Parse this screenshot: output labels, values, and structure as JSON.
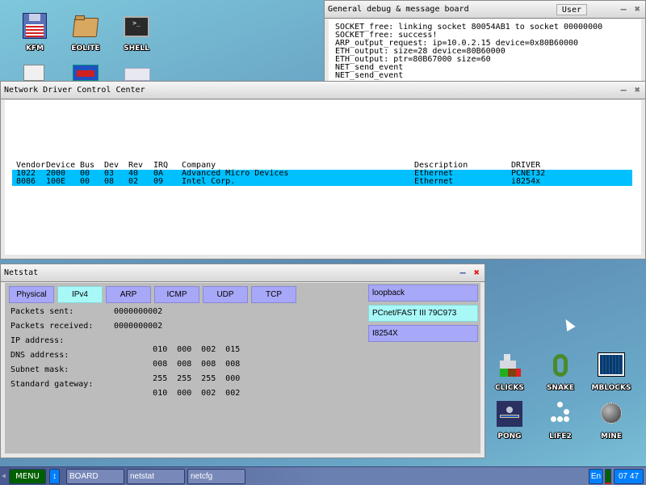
{
  "desktop": {
    "icons_top": [
      {
        "label": "KFM",
        "icon": "floppy-disk-icon"
      },
      {
        "label": "EOLITE",
        "icon": "folder-icon"
      },
      {
        "label": "SHELL",
        "icon": "terminal-icon"
      }
    ],
    "icons_games": [
      {
        "label": "CLICKS",
        "icon": "blocks-icon"
      },
      {
        "label": "SNAKE",
        "icon": "snake-icon"
      },
      {
        "label": "MBLOCKS",
        "icon": "grid-icon"
      },
      {
        "label": "PONG",
        "icon": "pong-icon"
      },
      {
        "label": "LIFE2",
        "icon": "life-icon"
      },
      {
        "label": "MINE",
        "icon": "mine-icon"
      }
    ]
  },
  "debug_board": {
    "title": "General debug & message board",
    "user_button": "User",
    "lines": [
      "SOCKET_free: linking socket 80054AB1 to socket 00000000",
      "SOCKET_free: success!",
      "ARP_output_request: ip=10.0.2.15 device=0x80B60000",
      "ETH_output: size=28 device=80B60000",
      "ETH_output: ptr=80B67000 size=60",
      "NET_send_event",
      "NET_send_event"
    ]
  },
  "driver_center": {
    "title": "Network Driver Control Center",
    "columns": [
      "Vendor",
      "Device",
      "Bus",
      "Dev",
      "Rev",
      "IRQ",
      "Company",
      "Description",
      "DRIVER"
    ],
    "rows": [
      [
        "1022",
        "2000",
        "00",
        "03",
        "40",
        "0A",
        "Advanced Micro Devices",
        "Ethernet",
        "PCNET32"
      ],
      [
        "8086",
        "100E",
        "00",
        "08",
        "02",
        "09",
        "Intel Corp.",
        "Ethernet",
        "i8254x"
      ]
    ]
  },
  "netstat": {
    "title": "Netstat",
    "tabs": [
      "Physical",
      "IPv4",
      "ARP",
      "ICMP",
      "UDP",
      "TCP"
    ],
    "active_tab": "IPv4",
    "stats": [
      {
        "label": "Packets sent:",
        "value": [
          "0000000002"
        ]
      },
      {
        "label": "Packets received:",
        "value": [
          "0000000002"
        ]
      },
      {
        "label": "IP address:",
        "value": [
          "010",
          "000",
          "002",
          "015"
        ]
      },
      {
        "label": "DNS address:",
        "value": [
          "008",
          "008",
          "008",
          "008"
        ]
      },
      {
        "label": "Subnet mask:",
        "value": [
          "255",
          "255",
          "255",
          "000"
        ]
      },
      {
        "label": "Standard gateway:",
        "value": [
          "010",
          "000",
          "002",
          "002"
        ]
      }
    ],
    "interfaces": [
      "loopback",
      "PCnet/FAST III 79C973",
      "I8254X"
    ],
    "active_interface": "PCnet/FAST III 79C973"
  },
  "taskbar": {
    "menu": "MENU",
    "switch_icon": "↕",
    "tasks": [
      "BOARD",
      "netstat",
      "netcfg"
    ],
    "lang": "En",
    "clock": "07 47"
  },
  "colors": {
    "selection": "#00c0ff",
    "tab_inactive": "#a8a8f8",
    "tab_active": "#a8f8f8",
    "menu_green": "#006000",
    "taskbar_blue": "#0080ff"
  }
}
